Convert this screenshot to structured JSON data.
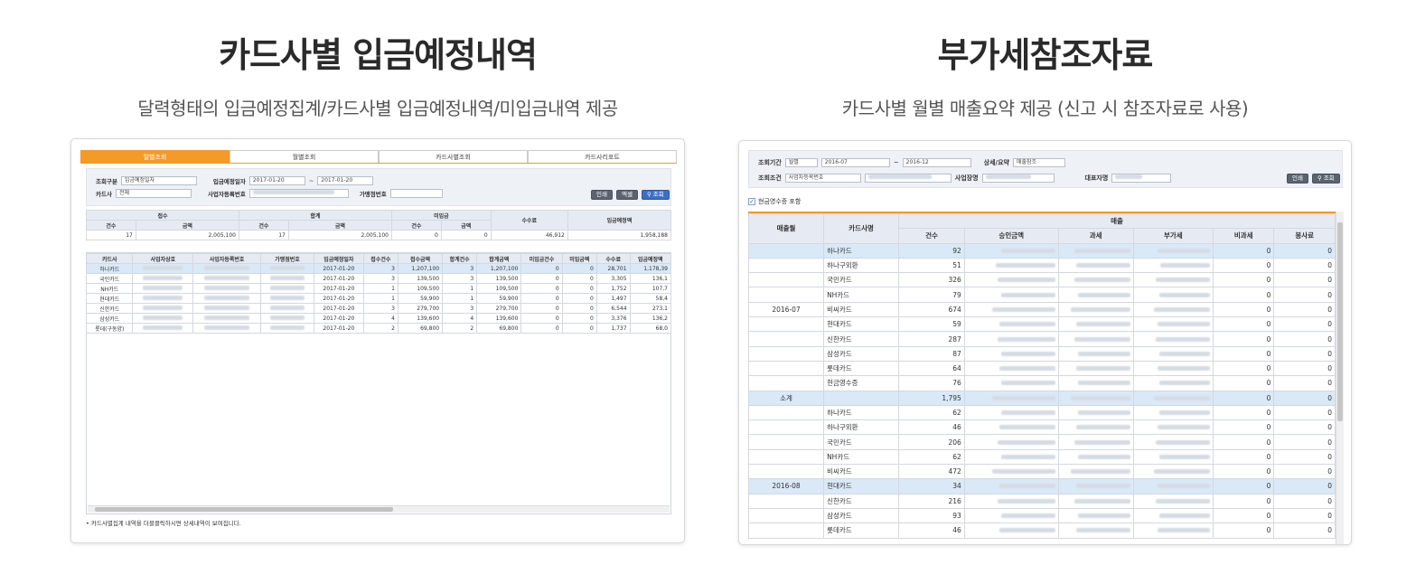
{
  "left": {
    "headline": "카드사별 입금예정내역",
    "subline": "달력형태의 입금예정집계/카드사별 입금예정내역/미입금내역 제공",
    "tabs": [
      "일별조회",
      "월별조회",
      "카드사별조회",
      "카드사리포트"
    ],
    "filter": {
      "type_label": "조회구분",
      "type_value": "입금예정일자",
      "date_label": "입금예정일자",
      "date_from": "2017-01-20",
      "date_sep": "~",
      "date_to": "2017-01-20",
      "card_label": "카드사",
      "card_value": "전체",
      "biz_label": "사업자등록번호",
      "merchant_label": "가맹점번호",
      "btn_print": "인쇄",
      "btn_excel": "엑셀",
      "btn_search": "조회"
    },
    "summary": {
      "groups": [
        "접수",
        "합계",
        "미입금",
        "수수료",
        "입금예정액"
      ],
      "sub": [
        "건수",
        "금액"
      ],
      "row": [
        "17",
        "2,005,100",
        "17",
        "2,005,100",
        "0",
        "0",
        "46,912",
        "1,958,188"
      ]
    },
    "grid": {
      "headers": [
        "카드사",
        "사업자상호",
        "사업자등록번호",
        "가맹점번호",
        "입금예정일자",
        "접수건수",
        "접수금액",
        "합계건수",
        "합계금액",
        "미입금건수",
        "미입금액",
        "수수료",
        "입금예정액"
      ],
      "rows": [
        [
          "하나카드",
          "2017-01-20",
          "3",
          "1,207,100",
          "3",
          "1,207,100",
          "0",
          "0",
          "28,701",
          "1,178,39"
        ],
        [
          "국민카드",
          "2017-01-20",
          "3",
          "139,500",
          "3",
          "139,500",
          "0",
          "0",
          "3,305",
          "136,1"
        ],
        [
          "NH카드",
          "2017-01-20",
          "1",
          "109,500",
          "1",
          "109,500",
          "0",
          "0",
          "1,752",
          "107,7"
        ],
        [
          "현대카드",
          "2017-01-20",
          "1",
          "59,900",
          "1",
          "59,900",
          "0",
          "0",
          "1,497",
          "58,4"
        ],
        [
          "신한카드",
          "2017-01-20",
          "3",
          "279,700",
          "3",
          "279,700",
          "0",
          "0",
          "6,544",
          "273,1"
        ],
        [
          "삼성카드",
          "2017-01-20",
          "4",
          "139,600",
          "4",
          "139,600",
          "0",
          "0",
          "3,376",
          "136,2"
        ],
        [
          "롯데(구동양)",
          "2017-01-20",
          "2",
          "69,800",
          "2",
          "69,800",
          "0",
          "0",
          "1,737",
          "68,0"
        ]
      ]
    },
    "note": "• 카드사별집계 내역을 더블클릭하시면 상세내역이 보여집니다."
  },
  "right": {
    "headline": "부가세참조자료",
    "subline": "카드사별 월별 매출요약 제공 (신고 시 참조자료로 사용)",
    "filter": {
      "period_label": "조회기간",
      "period_unit": "월별",
      "from": "2016-07",
      "sep": "~",
      "to": "2016-12",
      "detail_label": "상세/요약",
      "detail_value": "매출참조",
      "cond_label": "조회조건",
      "cond_value": "사업자등록번호",
      "bizname_label": "사업장명",
      "ceo_label": "대표자명",
      "btn_print": "인쇄",
      "btn_search": "조회"
    },
    "checkbox_label": "현금영수증 포함",
    "grid": {
      "h_month": "매출월",
      "h_card": "카드사명",
      "h_sales": "매출",
      "sub": [
        "건수",
        "승인금액",
        "과세",
        "부가세",
        "비과세",
        "봉사료"
      ],
      "rows": [
        [
          "",
          "하나카드",
          "92",
          "0",
          "0"
        ],
        [
          "",
          "하나구외환",
          "51",
          "0",
          "0"
        ],
        [
          "",
          "국민카드",
          "326",
          "0",
          "0"
        ],
        [
          "",
          "NH카드",
          "79",
          "0",
          "0"
        ],
        [
          "2016-07",
          "비씨카드",
          "674",
          "0",
          "0"
        ],
        [
          "",
          "현대카드",
          "59",
          "0",
          "0"
        ],
        [
          "",
          "신한카드",
          "287",
          "0",
          "0"
        ],
        [
          "",
          "삼성카드",
          "87",
          "0",
          "0"
        ],
        [
          "",
          "롯데카드",
          "64",
          "0",
          "0"
        ],
        [
          "",
          "현금영수증",
          "76",
          "0",
          "0"
        ],
        [
          "소계",
          "",
          "1,795",
          "0",
          "0"
        ],
        [
          "",
          "하나카드",
          "62",
          "0",
          "0"
        ],
        [
          "",
          "하나구외환",
          "46",
          "0",
          "0"
        ],
        [
          "",
          "국민카드",
          "206",
          "0",
          "0"
        ],
        [
          "",
          "NH카드",
          "62",
          "0",
          "0"
        ],
        [
          "",
          "비씨카드",
          "472",
          "0",
          "0"
        ],
        [
          "2016-08",
          "현대카드",
          "34",
          "0",
          "0"
        ],
        [
          "",
          "신한카드",
          "216",
          "0",
          "0"
        ],
        [
          "",
          "삼성카드",
          "93",
          "0",
          "0"
        ],
        [
          "",
          "롯데카드",
          "46",
          "0",
          "0"
        ]
      ]
    }
  }
}
